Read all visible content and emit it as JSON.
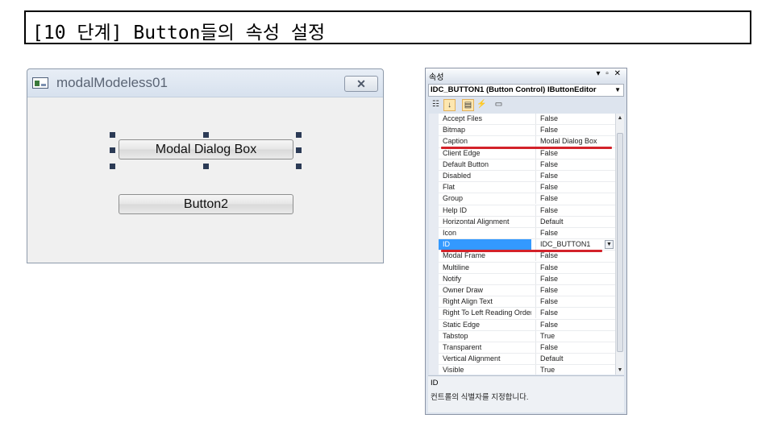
{
  "slide": {
    "title": "[10 단계] Button들의 속성 설정"
  },
  "dialog": {
    "title": "modalModeless01",
    "close_label": "✕",
    "buttons": [
      {
        "label": "Modal Dialog Box"
      },
      {
        "label": "Button2"
      }
    ]
  },
  "properties": {
    "panel_title": "속성",
    "header_controls": "▾ ▫ ✕",
    "object_selector": "IDC_BUTTON1 (Button Control) IButtonEditor",
    "rows": [
      {
        "name": "Accept Files",
        "value": "False"
      },
      {
        "name": "Bitmap",
        "value": "False"
      },
      {
        "name": "Caption",
        "value": "Modal Dialog Box"
      },
      {
        "name": "Client Edge",
        "value": "False"
      },
      {
        "name": "Default Button",
        "value": "False"
      },
      {
        "name": "Disabled",
        "value": "False"
      },
      {
        "name": "Flat",
        "value": "False"
      },
      {
        "name": "Group",
        "value": "False"
      },
      {
        "name": "Help ID",
        "value": "False"
      },
      {
        "name": "Horizontal Alignment",
        "value": "Default"
      },
      {
        "name": "Icon",
        "value": "False"
      },
      {
        "name": "ID",
        "value": "IDC_BUTTON1"
      },
      {
        "name": "Modal Frame",
        "value": "False"
      },
      {
        "name": "Multiline",
        "value": "False"
      },
      {
        "name": "Notify",
        "value": "False"
      },
      {
        "name": "Owner Draw",
        "value": "False"
      },
      {
        "name": "Right Align Text",
        "value": "False"
      },
      {
        "name": "Right To Left Reading Order",
        "value": "False"
      },
      {
        "name": "Static Edge",
        "value": "False"
      },
      {
        "name": "Tabstop",
        "value": "True"
      },
      {
        "name": "Transparent",
        "value": "False"
      },
      {
        "name": "Vertical Alignment",
        "value": "Default"
      },
      {
        "name": "Visible",
        "value": "True"
      }
    ],
    "selected_row": "ID",
    "description": {
      "title": "ID",
      "text": "컨트롤의 식별자를 지정합니다."
    }
  },
  "colors": {
    "selection": "#3399ff",
    "highlight_line": "#d3222a"
  }
}
